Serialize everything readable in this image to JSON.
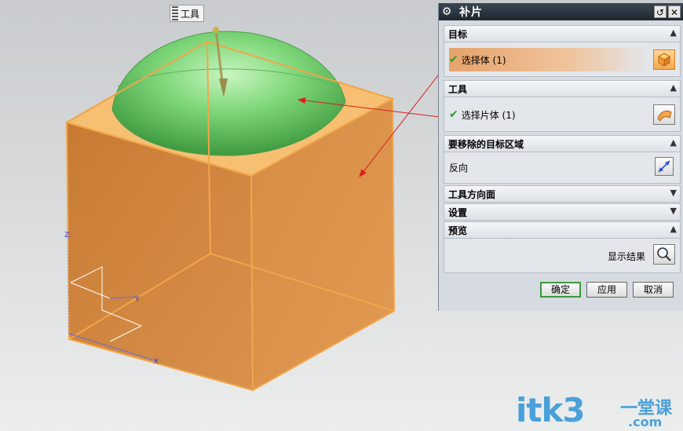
{
  "viewport": {
    "tool_tag": "工具",
    "triad_labels": {
      "x": "X",
      "y": "Y",
      "z": "Z"
    }
  },
  "dialog": {
    "title": "补片",
    "sections": {
      "target": {
        "header": "目标",
        "row": "选择体 (1)"
      },
      "tool": {
        "header": "工具",
        "row": "选择片体 (1)"
      },
      "region": {
        "header": "要移除的目标区域",
        "row": "反向"
      },
      "tool_direction": {
        "header": "工具方向面"
      },
      "settings": {
        "header": "设置"
      },
      "preview": {
        "header": "预览",
        "show_result": "显示结果"
      }
    },
    "buttons": {
      "ok": "确定",
      "apply": "应用",
      "cancel": "取消"
    }
  },
  "watermark": {
    "main": "itk3",
    "sub_cn": "一堂课",
    "sub_com": ".com"
  },
  "colors": {
    "box_orange": "#d98a3c",
    "dome_green": "#6fcf6f",
    "arrow_red": "#e01b1b",
    "accent_green": "#3a9a3a"
  }
}
